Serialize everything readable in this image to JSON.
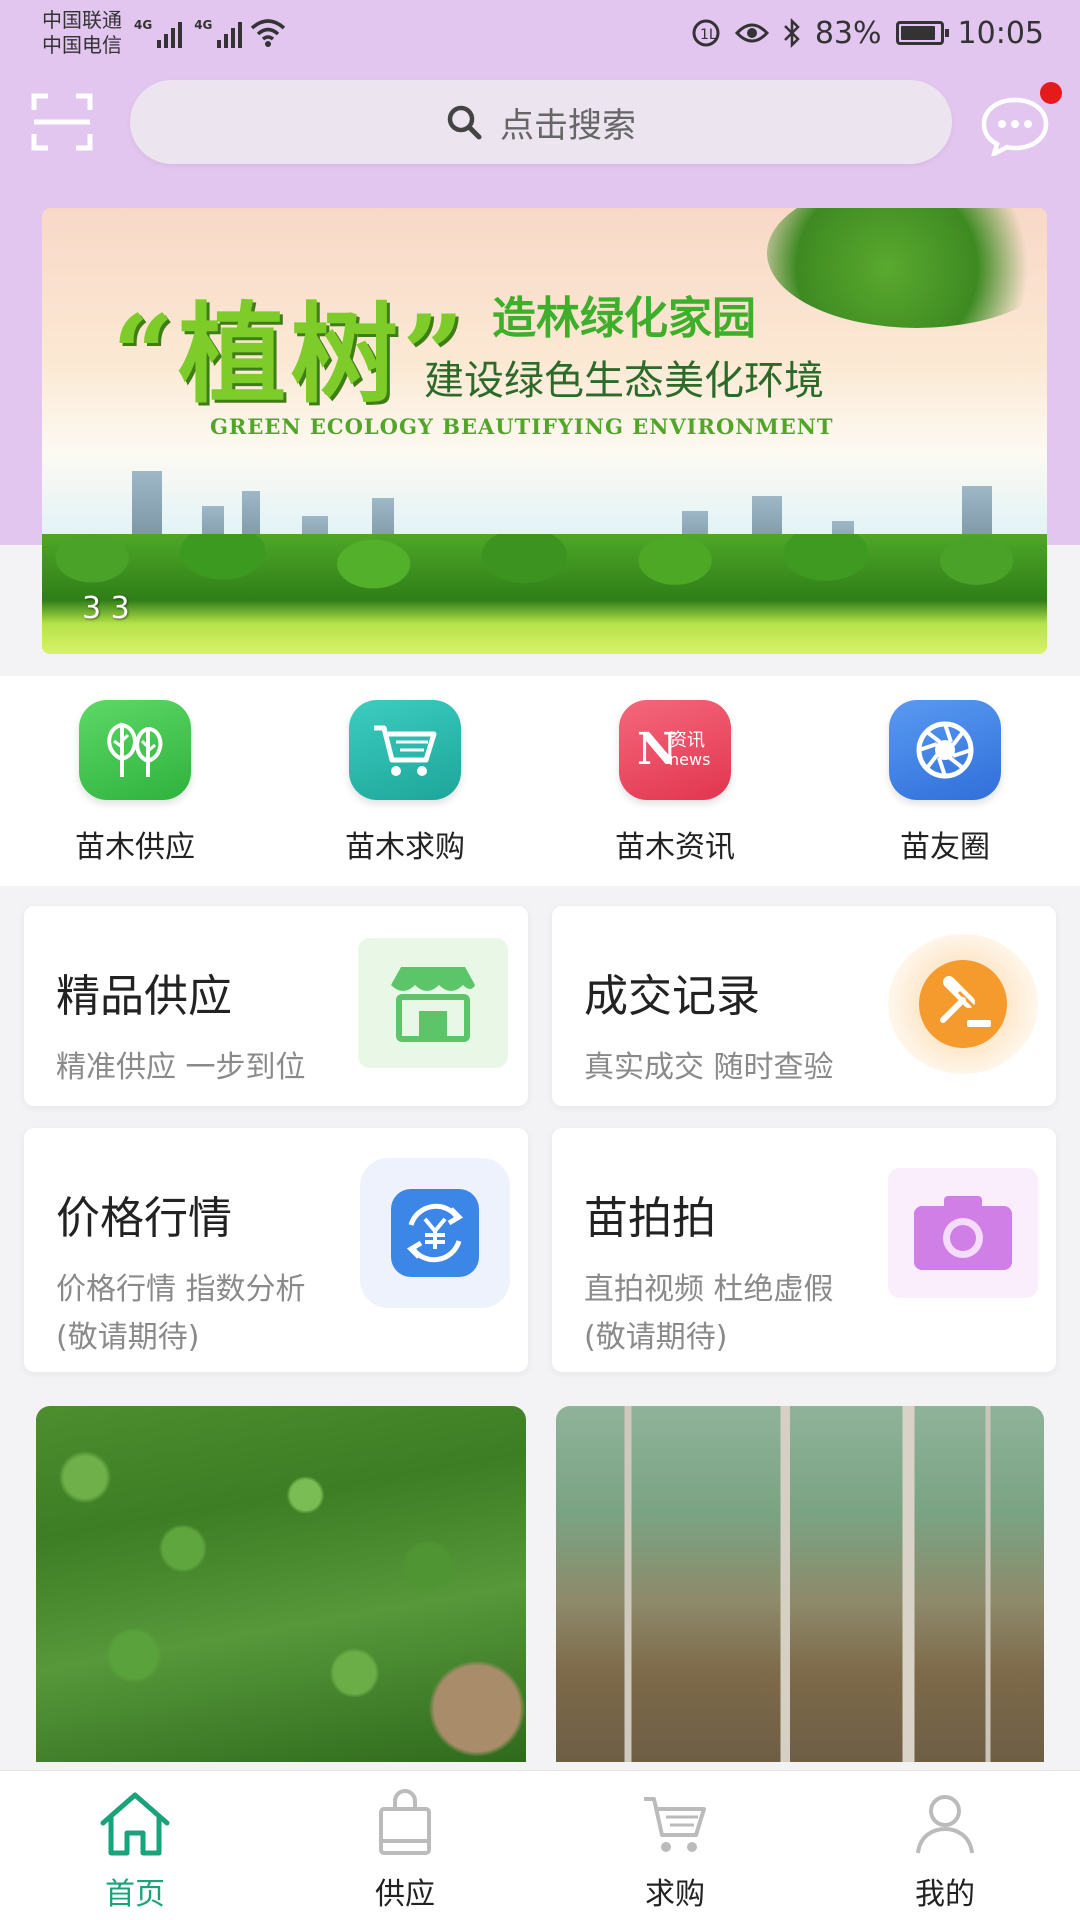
{
  "status_bar": {
    "carrier1": "中国联通",
    "carrier2": "中国电信",
    "net1": "4G",
    "net2": "4G",
    "battery": "83%",
    "time": "10:05"
  },
  "search": {
    "placeholder": "点击搜索"
  },
  "banner": {
    "title": "“植树”",
    "subtitle1": "造林绿化家园",
    "subtitle2": "建设绿色生态美化环境",
    "english": "GREEN   ECOLOGY   BEAUTIFYING   ENVIRONMENT",
    "counter": "3  3"
  },
  "quick_nav": [
    {
      "label": "苗木供应",
      "icon": "tree-icon",
      "color": "#3cc24a"
    },
    {
      "label": "苗木求购",
      "icon": "cart-icon",
      "color": "#22b6a9"
    },
    {
      "label": "苗木资讯",
      "icon": "news-icon",
      "color": "#e8455f"
    },
    {
      "label": "苗友圈",
      "icon": "aperture-icon",
      "color": "#3d7ee8"
    }
  ],
  "cards": {
    "premium_supply": {
      "title": "精品供应",
      "sub": "精准供应 一步到位"
    },
    "deal_records": {
      "title": "成交记录",
      "sub": "真实成交 随时查验"
    },
    "price_trends": {
      "title": "价格行情",
      "sub": "价格行情 指数分析",
      "note": "(敬请期待)"
    },
    "miao_paipai": {
      "title": "苗拍拍",
      "sub": "直拍视频 杜绝虚假",
      "note": "(敬请期待)"
    }
  },
  "news_icon_text": {
    "big": "N",
    "top": "资讯",
    "bottom": "news"
  },
  "bottom_nav": [
    {
      "label": "首页",
      "icon": "home-icon",
      "active": true
    },
    {
      "label": "供应",
      "icon": "bag-icon",
      "active": false
    },
    {
      "label": "求购",
      "icon": "cart-icon",
      "active": false
    },
    {
      "label": "我的",
      "icon": "user-icon",
      "active": false
    }
  ],
  "colors": {
    "accent": "#1aa37b",
    "header_bg": "#e3c6ef",
    "badge": "#e51b1b"
  }
}
